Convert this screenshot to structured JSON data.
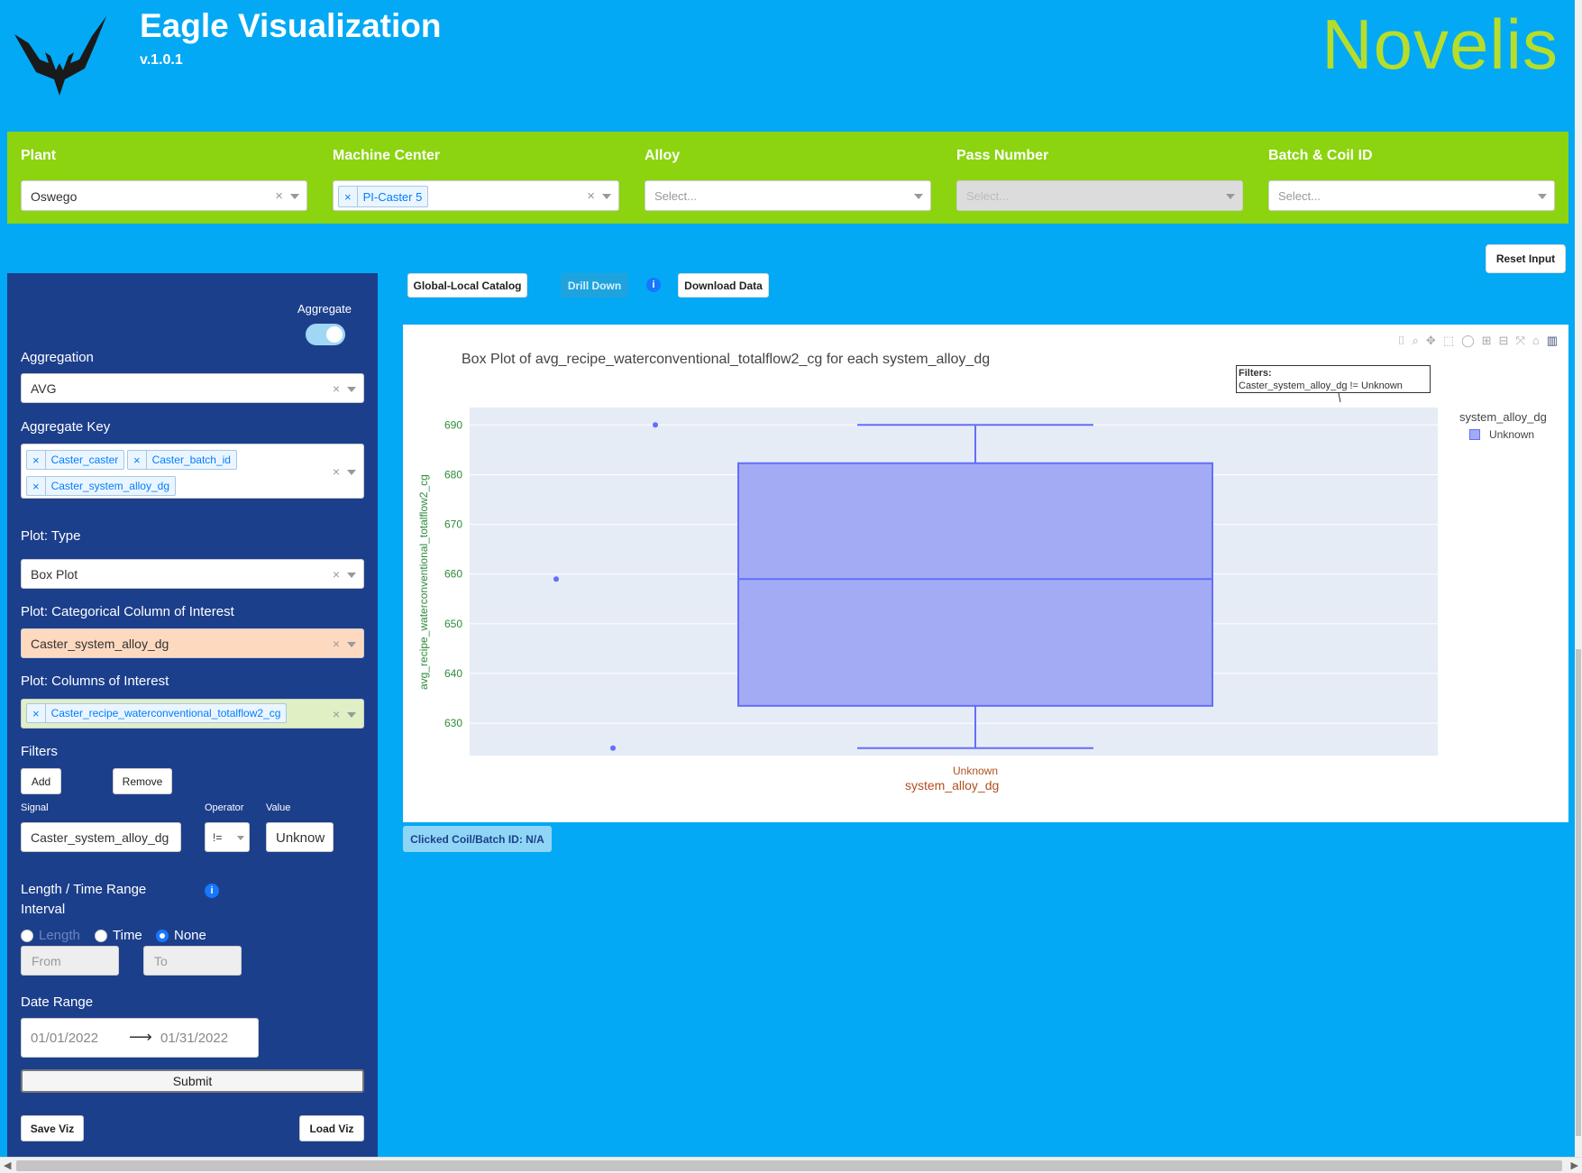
{
  "app": {
    "title": "Eagle Visualization",
    "version": "v.1.0.1",
    "brand": "Novelis"
  },
  "filters": {
    "plant": {
      "label": "Plant",
      "value": "Oswego"
    },
    "machine_center": {
      "label": "Machine Center",
      "value": "PI-Caster 5"
    },
    "alloy": {
      "label": "Alloy",
      "placeholder": "Select..."
    },
    "pass_number": {
      "label": "Pass Number",
      "placeholder": "Select..."
    },
    "batch_coil": {
      "label": "Batch & Coil ID",
      "placeholder": "Select..."
    }
  },
  "reset_label": "Reset Input",
  "sidebar": {
    "aggregate_label": "Aggregate",
    "aggregation_label": "Aggregation",
    "aggregation_value": "AVG",
    "aggregate_key_label": "Aggregate Key",
    "aggregate_keys": [
      "Caster_caster",
      "Caster_batch_id",
      "Caster_system_alloy_dg"
    ],
    "plot_type_label": "Plot: Type",
    "plot_type_value": "Box Plot",
    "cat_col_label": "Plot: Categorical Column of Interest",
    "cat_col_value": "Caster_system_alloy_dg",
    "cols_label": "Plot: Columns of Interest",
    "cols_value": "Caster_recipe_waterconventional_totalflow2_cg",
    "filters_label": "Filters",
    "add_label": "Add",
    "remove_label": "Remove",
    "signal_label": "Signal",
    "operator_label": "Operator",
    "value_label": "Value",
    "signal_value": "Caster_system_alloy_dg",
    "operator_value": "!=",
    "value_value": "Unknow",
    "range_label_1": "Length / Time Range",
    "range_label_2": "Interval",
    "radio_length": "Length",
    "radio_time": "Time",
    "radio_none": "None",
    "from_placeholder": "From",
    "to_placeholder": "To",
    "date_range_label": "Date Range",
    "date_from": "01/01/2022",
    "date_to": "01/31/2022",
    "submit_label": "Submit",
    "save_label": "Save Viz",
    "load_label": "Load Viz"
  },
  "toolbar": {
    "catalog_label": "Global-Local Catalog",
    "drill_label": "Drill Down",
    "download_label": "Download Data",
    "info_glyph": "i"
  },
  "clicked_label": "Clicked Coil/Batch ID: N/A",
  "chart_data": {
    "type": "box",
    "title": "Box Plot of avg_recipe_waterconventional_totalflow2_cg for each system_alloy_dg",
    "xlabel": "system_alloy_dg",
    "ylabel": "avg_recipe_waterconventional_totalflow2_cg",
    "categories": [
      "Unknown"
    ],
    "y_ticks": [
      630,
      640,
      650,
      660,
      670,
      680,
      690
    ],
    "ylim": [
      623.5,
      693.5
    ],
    "box": {
      "min": 625,
      "q1": 633.5,
      "median": 659,
      "q3": 682.3,
      "max": 690
    },
    "points": [
      690,
      659,
      625
    ],
    "legend_title": "system_alloy_dg",
    "legend_items": [
      "Unknown"
    ],
    "annotation_title": "Filters:",
    "annotation_text": "Caster_system_alloy_dg != Unknown",
    "box_fill": "#a3abf5",
    "box_line": "#636efa",
    "plot_bg": "#e5ecf6"
  }
}
